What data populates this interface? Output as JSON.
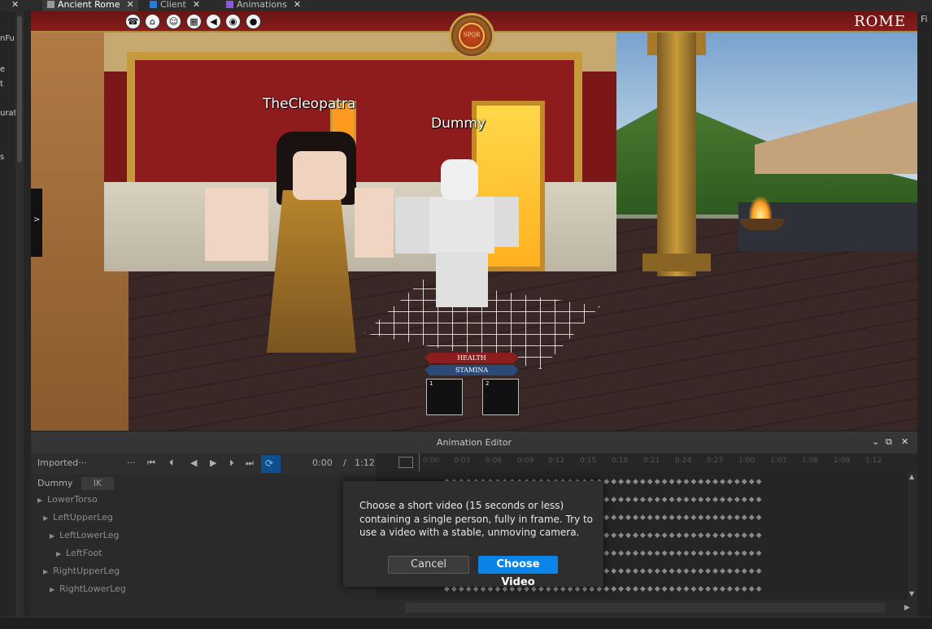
{
  "tabs": [
    {
      "label": "Ancient Rome",
      "active": true
    },
    {
      "label": "Client",
      "active": false
    },
    {
      "label": "Animations",
      "active": false
    }
  ],
  "left_panel": {
    "snippets": [
      "nFu",
      "e",
      "t",
      "urat",
      "s"
    ],
    "collapse_glyph": ">"
  },
  "right_panel": {
    "snippet": "Fi"
  },
  "game": {
    "hud_title": "ROME",
    "emblem_text": "SPQR",
    "hud_icons": [
      "shop-icon",
      "basket-icon",
      "people-icon",
      "map-icon",
      "sound-icon",
      "eye-icon",
      "location-icon"
    ],
    "names": {
      "player": "TheCleopatra",
      "dummy": "Dummy"
    },
    "bars": {
      "health": "HEALTH",
      "stamina": "STAMINA"
    },
    "slots": [
      "1",
      "2"
    ]
  },
  "animation_editor": {
    "title": "Animation Editor",
    "animation_name": "Imported···",
    "more": "···",
    "time_current": "0:00",
    "time_sep": "/",
    "time_total": "1:12",
    "rig_name": "Dummy",
    "ik_label": "IK",
    "tree": [
      {
        "label": "LowerTorso",
        "depth": 0
      },
      {
        "label": "LeftUpperLeg",
        "depth": 1
      },
      {
        "label": "LeftLowerLeg",
        "depth": 2
      },
      {
        "label": "LeftFoot",
        "depth": 3
      },
      {
        "label": "RightUpperLeg",
        "depth": 1
      },
      {
        "label": "RightLowerLeg",
        "depth": 2
      }
    ],
    "timeline_ticks": [
      "0:00",
      "0:03",
      "0:06",
      "0:09",
      "0:12",
      "0:15",
      "0:18",
      "0:21",
      "0:24",
      "0:27",
      "1:00",
      "1:03",
      "1:06",
      "1:09",
      "1:12"
    ]
  },
  "dialog": {
    "message": "Choose a short video (15 seconds or less) containing a single person, fully in frame. Try to use a video with a stable, unmoving camera.",
    "cancel_label": "Cancel",
    "choose_label": "Choose Video"
  },
  "colors": {
    "accent": "#0a84e8",
    "hud_red": "#8a1c1c",
    "health": "#8a1d1d",
    "stamina": "#2a4a7a"
  }
}
